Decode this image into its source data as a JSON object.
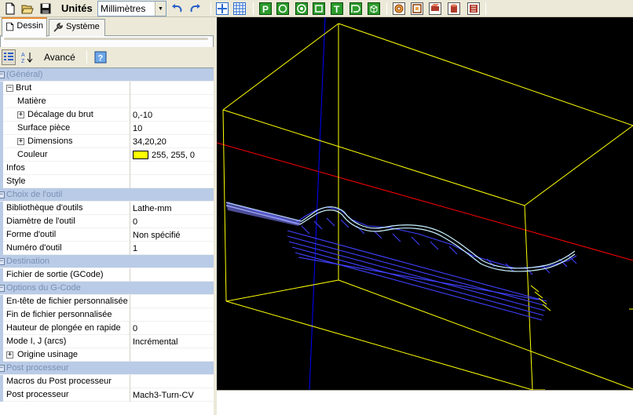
{
  "toolbar": {
    "units_label": "Unités",
    "units_value": "Millimètres",
    "icons": [
      "new-document-icon",
      "open-folder-icon",
      "save-disk-icon",
      "undo-icon",
      "redo-icon",
      "axes-view-icon",
      "grid-view-icon",
      "profile-p-icon",
      "circle-target-icon",
      "ring-icon",
      "square-icon",
      "text-t-icon",
      "curve-icon",
      "cube-icon",
      "spiral-icon",
      "frame-icon",
      "lathe-tool-icon",
      "cylinder-icon",
      "export-icon"
    ]
  },
  "tabs": [
    {
      "label": "Dessin",
      "icon": "document-icon"
    },
    {
      "label": "Système",
      "icon": "wrench-icon"
    }
  ],
  "pg_toolbar": {
    "advanced_label": "Avancé",
    "icons": [
      "categorized-icon",
      "alphabetical-az-icon",
      "help-icon"
    ]
  },
  "grid": {
    "general": "(Général)",
    "brut": "Brut",
    "matiere": "Matière",
    "decalage_label": "Décalage du brut",
    "decalage_value": "0,-10",
    "surface_label": "Surface pièce",
    "surface_value": "10",
    "dimensions_label": "Dimensions",
    "dimensions_value": "34,20,20",
    "couleur_label": "Couleur",
    "couleur_value": "255, 255, 0",
    "couleur_swatch": "#ffff00",
    "infos": "Infos",
    "style": "Style",
    "outil_cat": "Choix de l'outil",
    "biblio_label": "Bibliothèque d'outils",
    "biblio_value": "Lathe-mm",
    "diametre_label": "Diamètre de l'outil",
    "diametre_value": "0",
    "forme_label": "Forme d'outil",
    "forme_value": "Non spécifié",
    "numero_label": "Numéro d'outil",
    "numero_value": "1",
    "destination_cat": "Destination",
    "fichier_label": "Fichier de sortie (GCode)",
    "gcode_cat": "Options du G-Code",
    "entete_label": "En-tête de fichier personnalisée",
    "fin_label": "Fin de fichier personnalisée",
    "hauteur_label": "Hauteur de plongée en rapide",
    "hauteur_value": "0",
    "mode_label": "Mode I, J (arcs)",
    "mode_value": "Incrémental",
    "origine_label": "Origine usinage",
    "post_cat": "Post processeur",
    "macros_label": "Macros du Post processeur",
    "postproc_label": "Post processeur",
    "postproc_value": "Mach3-Turn-CV"
  },
  "colors": {
    "viewport_bg": "#000000",
    "stock_box": "#ffff00",
    "axis_x": "#ff0000",
    "axis_y": "#00a000",
    "axis_z": "#0000ff",
    "toolpath": "#4040ff",
    "profile": "#c8f0ff",
    "category_bg": "#b9cbe6"
  }
}
